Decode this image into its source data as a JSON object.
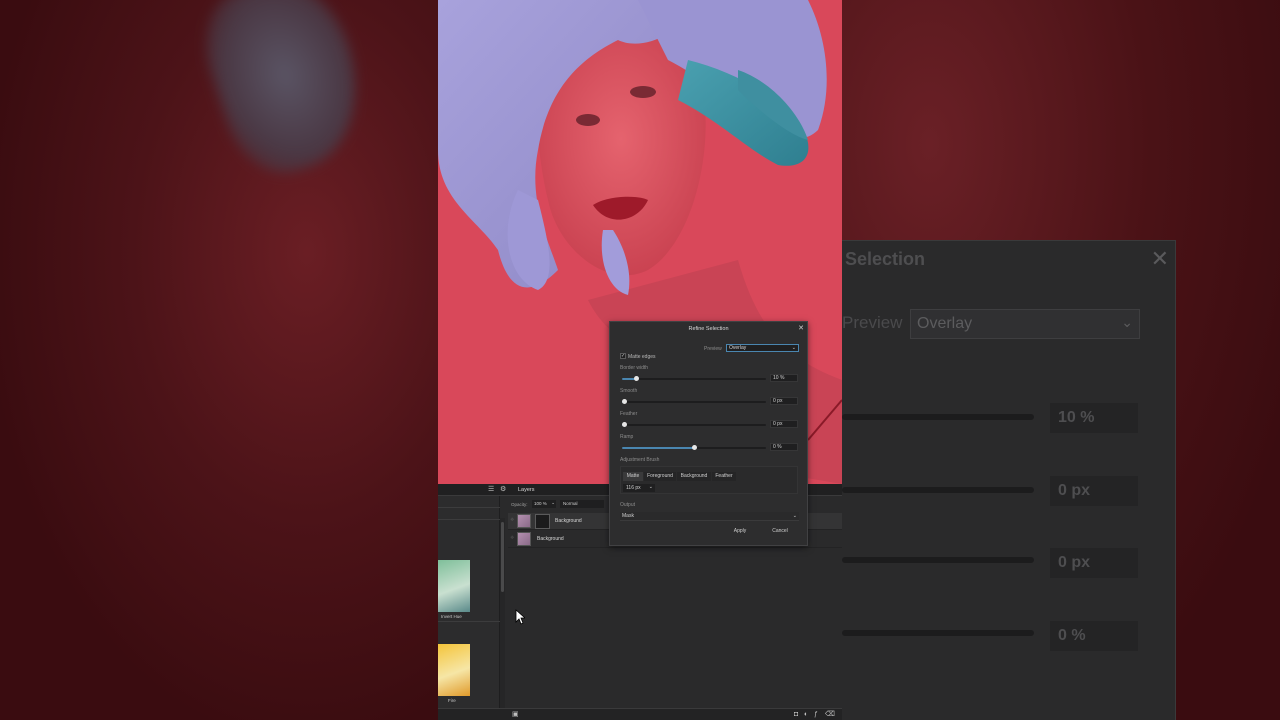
{
  "dialog": {
    "title": "Refine Selection",
    "preview_label": "Preview",
    "preview_value": "Overlay",
    "matte_edges_label": "Matte edges",
    "border_width_label": "Border width",
    "border_width_value": "10 %",
    "border_width_fraction": 0.1,
    "smooth_label": "Smooth",
    "smooth_value": "0 px",
    "smooth_fraction": 0,
    "feather_label": "Feather",
    "feather_value": "0 px",
    "feather_fraction": 0,
    "ramp_label": "Ramp",
    "ramp_value": "0 %",
    "ramp_fraction": 0.5,
    "adjustment_brush_label": "Adjustment Brush",
    "brush_modes": [
      "Matte",
      "Foreground",
      "Background",
      "Feather"
    ],
    "brush_size": "116 px",
    "output_label": "Output",
    "output_value": "Mask",
    "apply_label": "Apply",
    "cancel_label": "Cancel"
  },
  "layers_panel": {
    "tab_label": "Layers",
    "opacity_label": "Opacity:",
    "opacity_value": "100 %",
    "blend_mode": "Normal",
    "layers": [
      {
        "name": "Background"
      },
      {
        "name": "Background"
      }
    ]
  },
  "styles_panel": {
    "items": [
      {
        "label": "Invert Hue"
      },
      {
        "label": "Fire"
      }
    ]
  },
  "zoomed_dialog": {
    "title": "Selection",
    "preview_label": "Preview",
    "preview_value": "Overlay",
    "values": [
      "10 %",
      "0 px",
      "0 px",
      "0 %"
    ]
  },
  "colors": {
    "photo_background": "#d9485a",
    "panel": "#2a2a2b",
    "accent": "#4a86b0"
  }
}
